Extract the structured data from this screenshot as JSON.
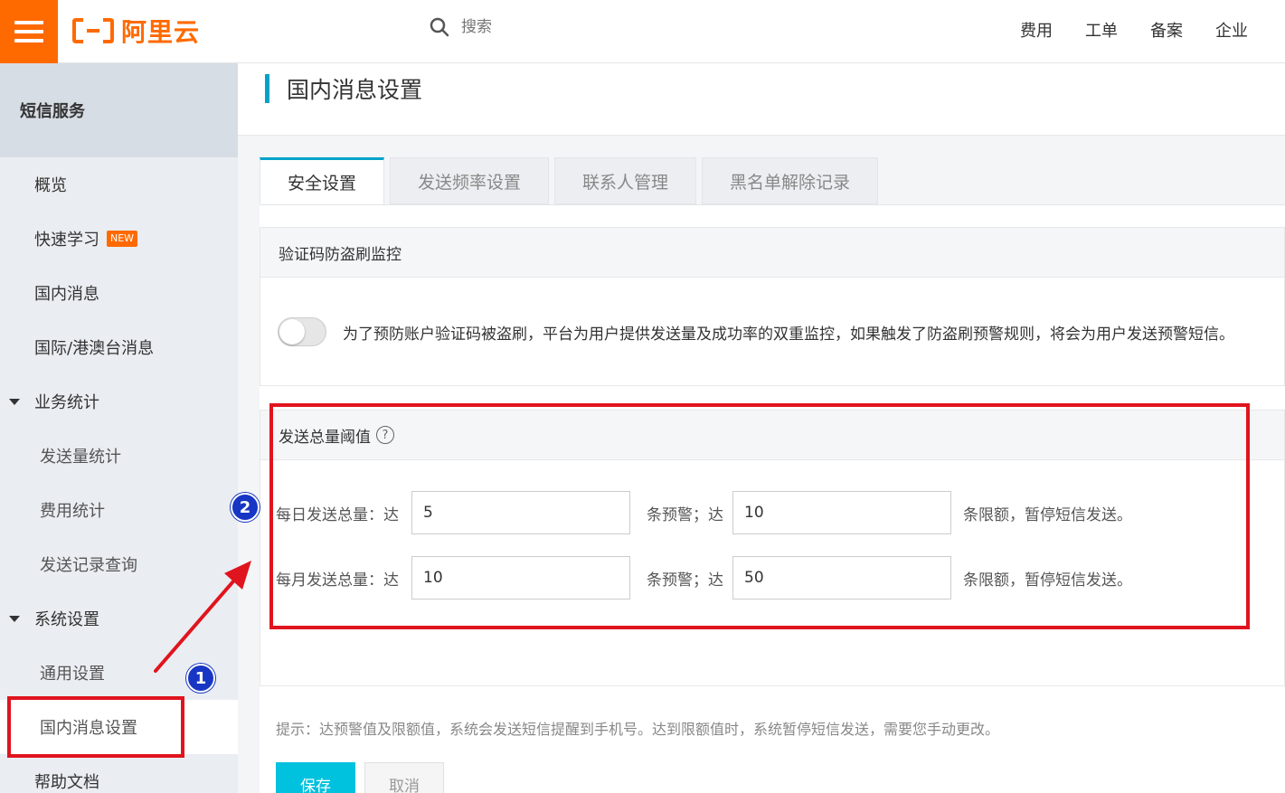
{
  "topbar": {
    "logo_text": "阿里云",
    "search_placeholder": "搜索",
    "nav": [
      "费用",
      "工单",
      "备案",
      "企业"
    ]
  },
  "sidebar": {
    "header": "短信服务",
    "items": [
      {
        "label": "概览"
      },
      {
        "label": "快速学习",
        "badge": "NEW"
      },
      {
        "label": "国内消息"
      },
      {
        "label": "国际/港澳台消息"
      },
      {
        "label": "业务统计"
      },
      {
        "label": "发送量统计"
      },
      {
        "label": "费用统计"
      },
      {
        "label": "发送记录查询"
      },
      {
        "label": "系统设置"
      },
      {
        "label": "通用设置"
      },
      {
        "label": "国内消息设置"
      },
      {
        "label": "帮助文档"
      }
    ]
  },
  "main": {
    "page_title": "国内消息设置",
    "tabs": [
      "安全设置",
      "发送频率设置",
      "联系人管理",
      "黑名单解除记录"
    ],
    "captcha_section": {
      "title": "验证码防盗刷监控",
      "description": "为了预防账户验证码被盗刷，平台为用户提供发送量及成功率的双重监控，如果触发了防盗刷预警规则，将会为用户发送预警短信。"
    },
    "threshold_section": {
      "title": "发送总量阈值",
      "help": "?",
      "daily_label": "每日发送总量：达",
      "daily_warn_value": "5",
      "daily_mid_label": "条预警；达",
      "daily_limit_value": "10",
      "daily_suffix": "条限额，暂停短信发送。",
      "monthly_label": "每月发送总量：达",
      "monthly_warn_value": "10",
      "monthly_mid_label": "条预警；达",
      "monthly_limit_value": "50",
      "monthly_suffix": "条限额，暂停短信发送。"
    },
    "hint": "提示：达预警值及限额值，系统会发送短信提醒到手机号。达到限额值时，系统暂停短信发送，需要您手动更改。",
    "save_label": "保存",
    "cancel_label": "取消"
  },
  "annotations": {
    "step1": "1",
    "step2": "2",
    "color": "#e0141e"
  }
}
